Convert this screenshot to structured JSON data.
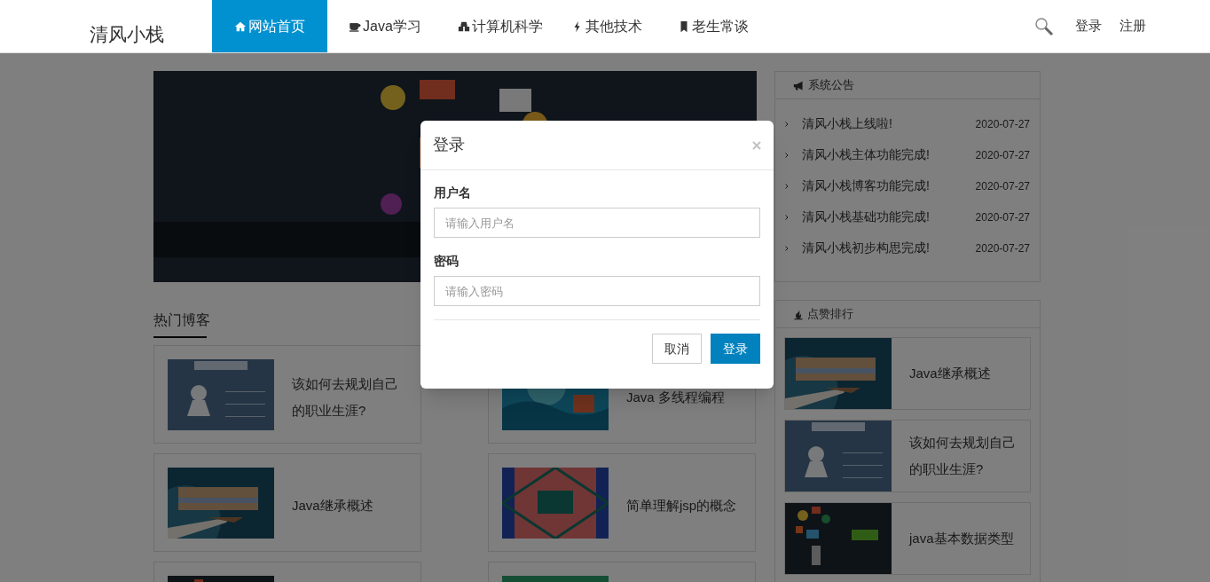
{
  "nav": {
    "logo": "清风小栈",
    "items": [
      {
        "label": "网站首页",
        "selected": true
      },
      {
        "label": "Java学习",
        "selected": false
      },
      {
        "label": "计算机科学",
        "selected": false
      },
      {
        "label": "其他技术",
        "selected": false
      },
      {
        "label": "老生常谈",
        "selected": false
      }
    ],
    "links": [
      "登录",
      "注册"
    ]
  },
  "banner": {
    "kind": "picture"
  },
  "hot_blogs": {
    "title": "热门博客",
    "posts": [
      {
        "title": "该如何去规划自己的职业生涯?"
      },
      {
        "title": "Java 多线程编程"
      },
      {
        "title": "Java继承概述"
      },
      {
        "title": "简单理解jsp的概念"
      },
      {
        "kind": "picture"
      },
      {
        "kind": "picture"
      }
    ]
  },
  "announcements": {
    "title": "系统公告",
    "items": [
      {
        "text": "清风小栈上线啦!",
        "date": "2020-07-27"
      },
      {
        "text": "清风小栈主体功能完成!",
        "date": "2020-07-27"
      },
      {
        "text": "清风小栈博客功能完成!",
        "date": "2020-07-27"
      },
      {
        "text": "清风小栈基础功能完成!",
        "date": "2020-07-27"
      },
      {
        "text": "清风小栈初步构思完成!",
        "date": "2020-07-27"
      }
    ]
  },
  "likes_ranking": {
    "title": "点赞排行",
    "posts": [
      {
        "title": "Java继承概述"
      },
      {
        "title": "该如何去规划自己的职业生涯?"
      },
      {
        "title": "java基本数据类型"
      }
    ]
  },
  "login_dialog": {
    "title": "登录",
    "fields": [
      {
        "label": "用户名",
        "placeholder": "请输入用户名"
      },
      {
        "label": "密码",
        "placeholder": "请输入密码"
      }
    ],
    "buttons": [
      {
        "label": "取消",
        "kind": "default"
      },
      {
        "label": "登录",
        "kind": "primary"
      }
    ]
  }
}
